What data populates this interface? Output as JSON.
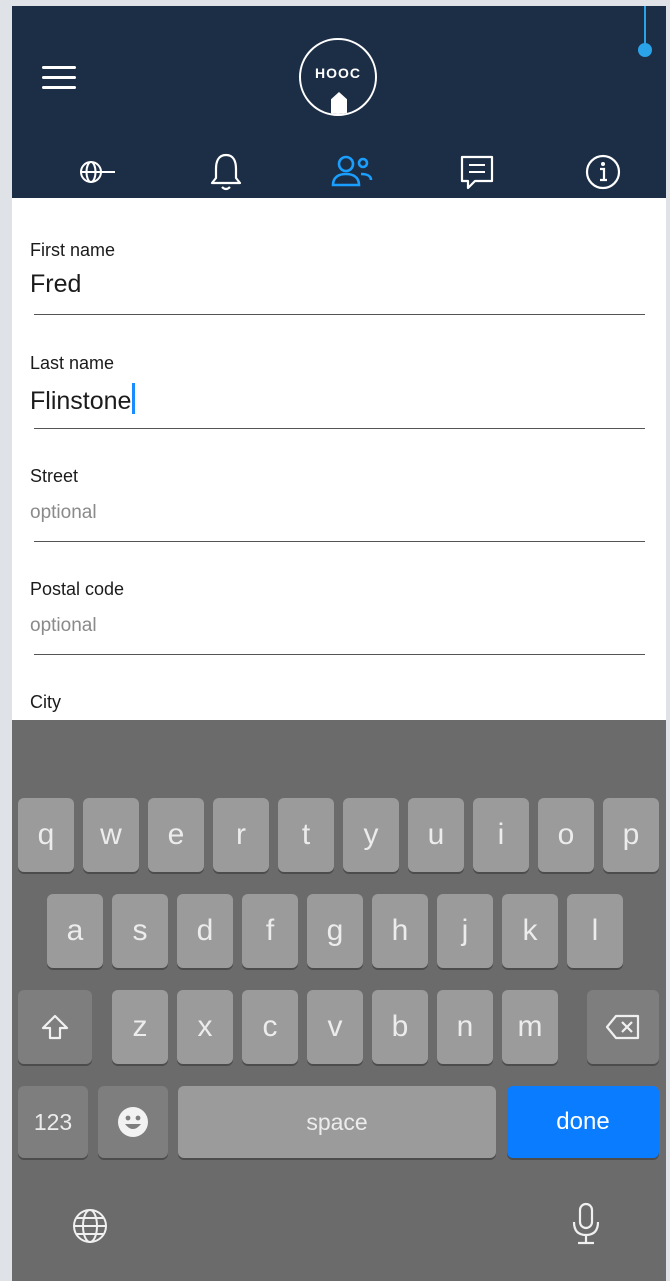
{
  "header": {
    "logo_text": "HOOC",
    "tabs": [
      {
        "id": "globe",
        "icon": "globe-key-icon",
        "active": false
      },
      {
        "id": "notifications",
        "icon": "bell-icon",
        "active": false
      },
      {
        "id": "users",
        "icon": "users-icon",
        "active": true
      },
      {
        "id": "messages",
        "icon": "chat-icon",
        "active": false
      },
      {
        "id": "info",
        "icon": "info-icon",
        "active": false
      }
    ],
    "active_color": "#1a9fff",
    "background_color": "#1c2e46"
  },
  "form": {
    "fields": [
      {
        "label": "First name",
        "value": "Fred",
        "placeholder": ""
      },
      {
        "label": "Last name",
        "value": "Flinstone",
        "placeholder": "",
        "focused": true
      },
      {
        "label": "Street",
        "value": "",
        "placeholder": "optional"
      },
      {
        "label": "Postal code",
        "value": "",
        "placeholder": "optional"
      },
      {
        "label": "City",
        "value": "",
        "placeholder": ""
      }
    ]
  },
  "keyboard": {
    "row1": [
      "q",
      "w",
      "e",
      "r",
      "t",
      "y",
      "u",
      "i",
      "o",
      "p"
    ],
    "row2": [
      "a",
      "s",
      "d",
      "f",
      "g",
      "h",
      "j",
      "k",
      "l"
    ],
    "row3": [
      "z",
      "x",
      "c",
      "v",
      "b",
      "n",
      "m"
    ],
    "numbers_label": "123",
    "space_label": "space",
    "done_label": "done",
    "icons": {
      "shift": "shift-icon",
      "delete": "backspace-icon",
      "emoji": "emoji-icon",
      "globe": "globe-icon",
      "mic": "microphone-icon"
    },
    "done_color": "#0a7cff"
  }
}
